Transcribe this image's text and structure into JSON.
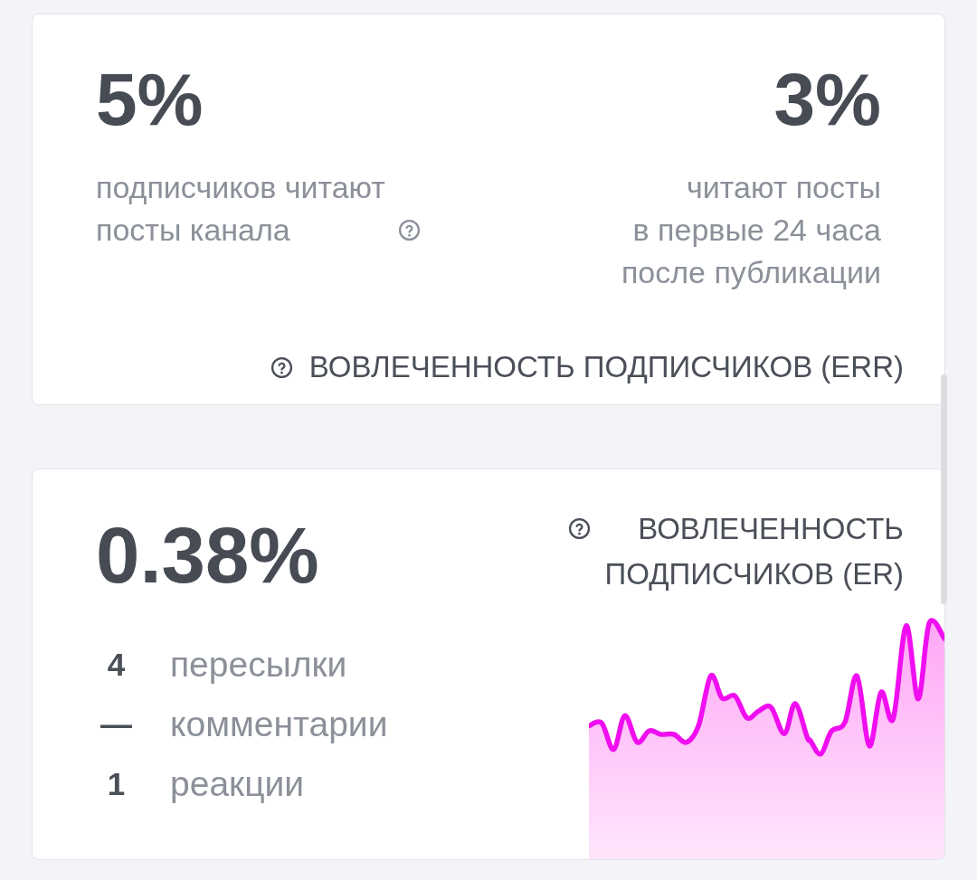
{
  "cards": [
    {
      "kind": "err",
      "stats": [
        {
          "value": "5%",
          "caption": "подписчиков читают\nпосты канала",
          "help": true
        },
        {
          "value": "3%",
          "caption": "читают посты\nв первые 24 часа\nпосле публикации",
          "help": false
        }
      ],
      "footer": "ВОВЛЕЧЕННОСТЬ ПОДПИСЧИКОВ (ERR)"
    },
    {
      "kind": "er",
      "value": "0.38%",
      "title": "ВОВЛЕЧЕННОСТЬ\nПОДПИСЧИКОВ (ER)",
      "metrics": [
        {
          "count": "4",
          "label": "пересылки"
        },
        {
          "count": "—",
          "label": "комментарии"
        },
        {
          "count": "1",
          "label": "реакции"
        }
      ]
    }
  ]
}
